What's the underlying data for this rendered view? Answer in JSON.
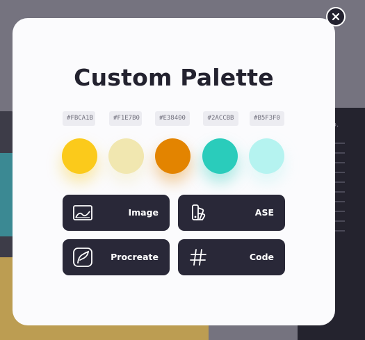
{
  "modal": {
    "title": "Custom Palette"
  },
  "palette": [
    {
      "hex": "#FBCA1B",
      "color": "#FBCA1B"
    },
    {
      "hex": "#F1E7B0",
      "color": "#F1E7B0"
    },
    {
      "hex": "#E38400",
      "color": "#E38400"
    },
    {
      "hex": "#2ACCBB",
      "color": "#2ACCBB"
    },
    {
      "hex": "#B5F3F0",
      "color": "#B5F3F0"
    }
  ],
  "exports": [
    {
      "label": "Image",
      "icon": "image-icon"
    },
    {
      "label": "ASE",
      "icon": "swatches-icon"
    },
    {
      "label": "Procreate",
      "icon": "procreate-icon"
    },
    {
      "label": "Code",
      "icon": "hash-icon"
    }
  ],
  "background": {
    "brand_fragment": "lse Co."
  },
  "colors": {
    "button_bg": "#292838",
    "title": "#23222f"
  }
}
